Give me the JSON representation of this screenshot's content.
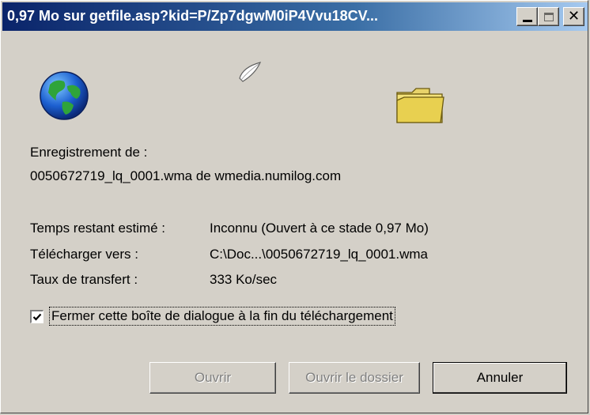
{
  "window": {
    "title": "0,97 Mo sur getfile.asp?kid=P/Zp7dgwM0iP4Vvu18CV..."
  },
  "icons": {
    "globe": "globe-icon",
    "paper": "flying-paper-icon",
    "folder": "folder-icon"
  },
  "download": {
    "saving_label": "Enregistrement de :",
    "file_source": "0050672719_lq_0001.wma de wmedia.numilog.com",
    "time_label": "Temps restant estimé :",
    "time_value": "Inconnu (Ouvert à ce stade 0,97 Mo)",
    "dest_label": "Télécharger vers :",
    "dest_value": "C:\\Doc...\\0050672719_lq_0001.wma",
    "rate_label": "Taux de transfert :",
    "rate_value": "333 Ko/sec"
  },
  "close_when_done": {
    "label": "Fermer cette boîte de dialogue à la fin du téléchargement",
    "checked": true
  },
  "buttons": {
    "open": "Ouvrir",
    "open_folder": "Ouvrir le dossier",
    "cancel": "Annuler"
  },
  "colors": {
    "titlebar_start": "#0a246a",
    "titlebar_end": "#a6caf0",
    "face": "#d4d0c8"
  }
}
